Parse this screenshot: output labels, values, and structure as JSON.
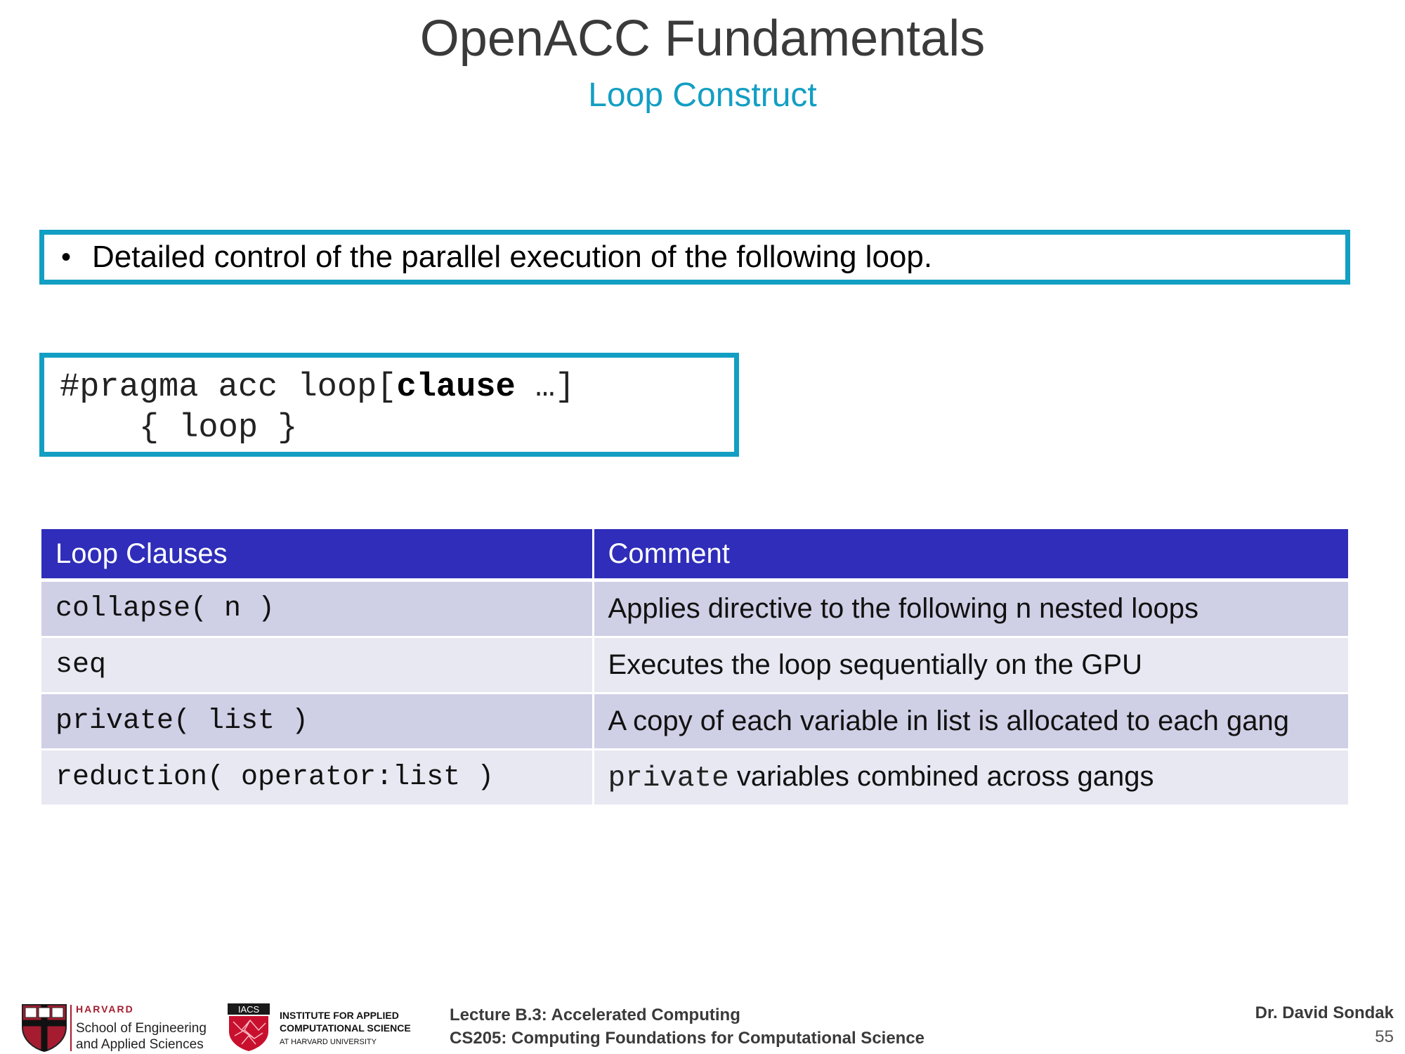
{
  "slide": {
    "title": "OpenACC Fundamentals",
    "subtitle": "Loop Construct"
  },
  "bullet": {
    "marker": "•",
    "text": "Detailed control of the parallel execution of the following loop."
  },
  "code": {
    "line1_prefix": "#pragma acc loop[",
    "line1_keyword": "clause",
    "line1_suffix": " …]",
    "line2": "    { loop }"
  },
  "table": {
    "headers": [
      "Loop Clauses",
      "Comment"
    ],
    "rows": [
      {
        "clause": "collapse( n )",
        "comment": "Applies directive to the following n nested loops"
      },
      {
        "clause": "seq",
        "comment": "Executes the loop sequentially on the GPU"
      },
      {
        "clause": "private( list )",
        "comment": "A copy of each variable in list is allocated to each gang"
      },
      {
        "clause": "reduction( operator:list )",
        "comment_code": "private",
        "comment": " variables combined across gangs"
      }
    ]
  },
  "footer": {
    "harvard_word": "HARVARD",
    "seas_line1": "School of Engineering",
    "seas_line2": "and Applied Sciences",
    "iacs_badge": "IACS",
    "iacs_line1": "INSTITUTE FOR APPLIED",
    "iacs_line2": "COMPUTATIONAL SCIENCE",
    "iacs_line3": "AT HARVARD UNIVERSITY",
    "lecture": "Lecture B.3: Accelerated Computing",
    "course": "CS205: Computing Foundations for Computational Science",
    "author": "Dr. David Sondak",
    "page_number": "55"
  }
}
